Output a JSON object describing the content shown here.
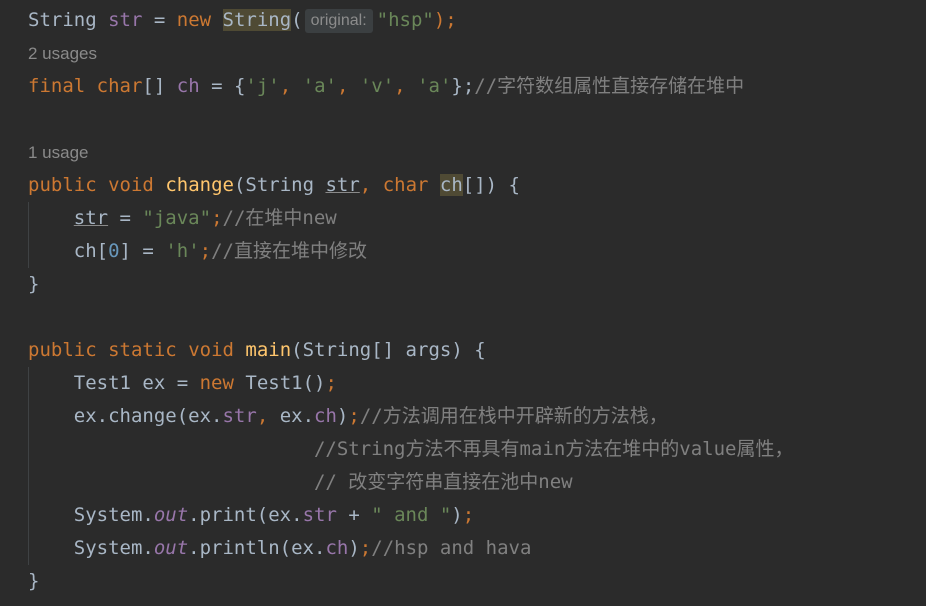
{
  "editor": {
    "hints": {
      "usages_ch": "2 usages",
      "usages_change": "1 usage",
      "param_original": "original:"
    },
    "code": {
      "l1_type": "String",
      "l1_var": "str",
      "l1_eq": " = ",
      "l1_new": "new",
      "l1_ctor": "String",
      "l1_paren": "(",
      "l1_str": "\"hsp\"",
      "l1_end": ");",
      "l3_final": "final",
      "l3_char": "char",
      "l3_brackets": "[] ",
      "l3_var": "ch",
      "l3_eq": " = {",
      "l3_c1": "'j'",
      "l3_c2": "'a'",
      "l3_c3": "'v'",
      "l3_c4": "'a'",
      "l3_close": "};",
      "l3_comment": "//字符数组属性直接存储在堆中",
      "l5_public": "public",
      "l5_void": "void",
      "l5_name": "change",
      "l5_open": "(String ",
      "l5_param1": "str",
      "l5_char": "char",
      "l5_param2": "ch",
      "l5_close": "[]) {",
      "l6_var": "str",
      "l6_eq": " = ",
      "l6_str": "\"java\"",
      "l6_semi": ";",
      "l6_comment": "//在堆中new",
      "l7_var": "ch[",
      "l7_idx": "0",
      "l7_mid": "] = ",
      "l7_chr": "'h'",
      "l7_semi": ";",
      "l7_comment": "//直接在堆中修改",
      "l8_brace": "}",
      "l10_public": "public",
      "l10_static": "static",
      "l10_void": "void",
      "l10_name": "main",
      "l10_rest": "(String[] args) {",
      "l11_type": "Test1 ex = ",
      "l11_new": "new",
      "l11_ctor": " Test1()",
      "l11_semi": ";",
      "l12_a": "ex.change(ex.",
      "l12_f1": "str",
      "l12_comma": ",",
      "l12_b": " ex.",
      "l12_f2": "ch",
      "l12_c": ")",
      "l12_semi": ";",
      "l12_comment": "//方法调用在栈中开辟新的方法栈，",
      "l13_comment": "//String方法不再具有main方法在堆中的value属性，",
      "l14_comment": "// 改变字符串直接在池中new",
      "l15_a": "System.",
      "l15_out": "out",
      "l15_b": ".print(ex.",
      "l15_f": "str",
      "l15_plus": " + ",
      "l15_str": "\" and \"",
      "l15_c": ")",
      "l15_semi": ";",
      "l16_a": "System.",
      "l16_out": "out",
      "l16_b": ".println(ex.",
      "l16_f": "ch",
      "l16_c": ")",
      "l16_semi": ";",
      "l16_comment": "//hsp and hava",
      "l17_brace": "}"
    }
  }
}
